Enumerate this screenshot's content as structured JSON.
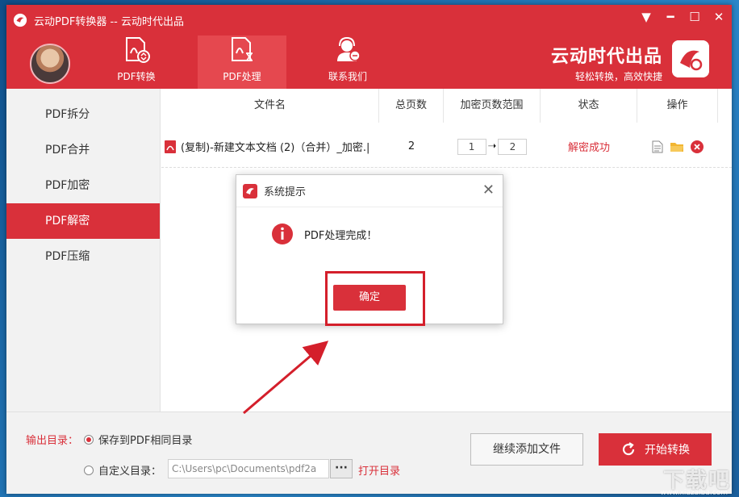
{
  "window": {
    "title": "云动PDF转换器 -- 云动时代出品",
    "controls": [
      "▼",
      "━",
      "☐",
      "✕"
    ]
  },
  "nav": {
    "tabs": [
      {
        "label": "PDF转换",
        "icon": "pdf-convert-icon",
        "active": false
      },
      {
        "label": "PDF处理",
        "icon": "pdf-process-icon",
        "active": true
      },
      {
        "label": "联系我们",
        "icon": "contact-support-icon",
        "active": false
      }
    ]
  },
  "brand": {
    "title": "云动时代出品",
    "subtitle": "轻松转换，高效快捷"
  },
  "sidebar": {
    "items": [
      {
        "label": "PDF拆分",
        "active": false
      },
      {
        "label": "PDF合并",
        "active": false
      },
      {
        "label": "PDF加密",
        "active": false
      },
      {
        "label": "PDF解密",
        "active": true
      },
      {
        "label": "PDF压缩",
        "active": false
      }
    ]
  },
  "table": {
    "headers": [
      "文件名",
      "总页数",
      "加密页数范围",
      "状态",
      "操作"
    ],
    "rows": [
      {
        "filename": "(复制)-新建文本文档 (2)（合并）_加密.|",
        "pages": "2",
        "range_from": "1",
        "range_to": "2",
        "status": "解密成功"
      }
    ]
  },
  "bottom": {
    "output_label": "输出目录：",
    "option_same_dir": "保存到PDF相同目录",
    "option_custom_dir": "自定义目录：",
    "path_value": "C:\\Users\\pc\\Documents\\pdf2a",
    "browse_label": "···",
    "open_dir": "打开目录",
    "add_files": "继续添加文件",
    "start": "开始转换"
  },
  "dialog": {
    "title": "系统提示",
    "close": "✕",
    "message": "PDF处理完成！",
    "ok": "确定"
  },
  "watermark": {
    "text": "下载吧",
    "sub": "www.xiazaiba.com"
  },
  "colors": {
    "brand_red": "#d9303a",
    "sidebar_bg": "#f2f2f2"
  }
}
